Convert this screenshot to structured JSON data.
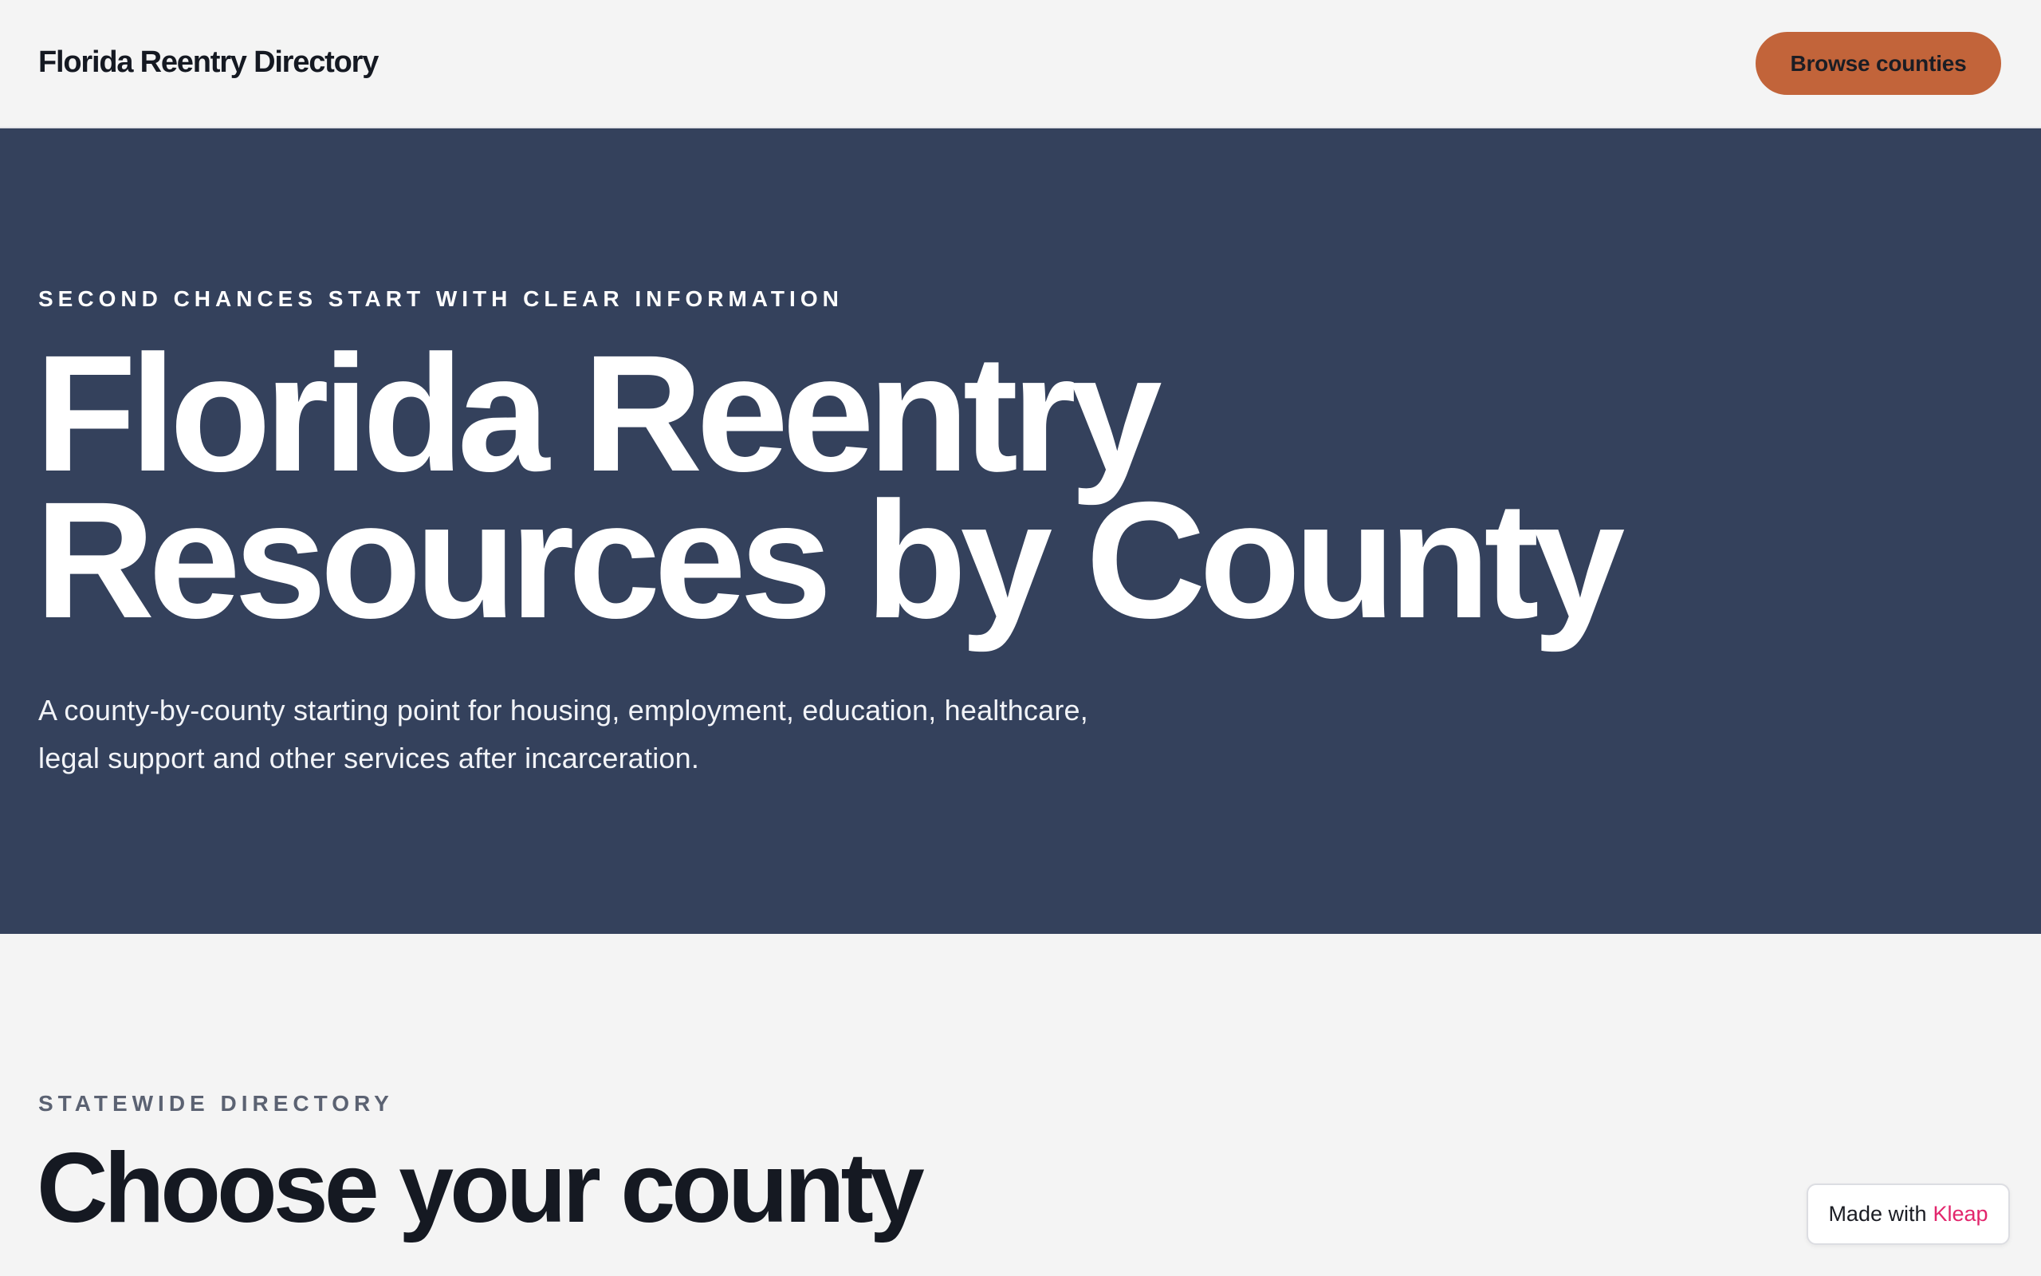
{
  "header": {
    "brand": "Florida Reentry Directory",
    "browse_button_label": "Browse counties"
  },
  "hero": {
    "eyebrow": "SECOND CHANCES START WITH CLEAR INFORMATION",
    "title_lines": [
      "Florida Reentry",
      "Resources by County"
    ],
    "lede": "A county-by-county starting point for housing, employment, education, healthcare, legal support and other services after incarceration."
  },
  "directory": {
    "eyebrow": "STATEWIDE DIRECTORY",
    "title": "Choose your county"
  },
  "badge": {
    "prefix": "Made with",
    "brand": "Kleap"
  },
  "colors": {
    "page_background": "#f4f4f4",
    "hero_background": "#34415c",
    "accent_button": "#c2643a",
    "badge_brand": "#e2256c",
    "heading_text": "#151922"
  }
}
